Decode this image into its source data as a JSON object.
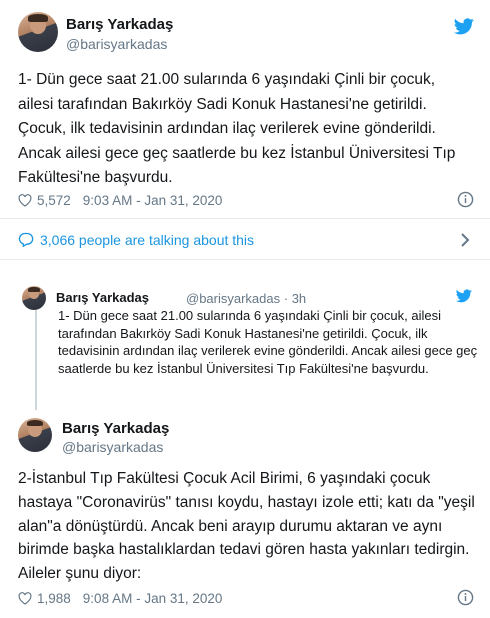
{
  "tweet1": {
    "author_name": "Barış Yarkadaş",
    "author_handle": "@barisyarkadas",
    "text": "1- Dün gece saat 21.00 sularında 6 yaşındaki Çinli bir çocuk, ailesi tarafından Bakırköy Sadi Konuk Hastanesi'ne getirildi. Çocuk, ilk tedavisinin ardından ilaç verilerek evine gönderildi. Ancak ailesi gece geç saatlerde bu kez İstanbul Üniversitesi Tıp Fakültesi'ne başvurdu.",
    "likes": "5,572",
    "timestamp": "9:03 AM - Jan 31, 2020",
    "talking": "3,066 people are talking about this"
  },
  "quoted": {
    "author_name": "Barış Yarkadaş",
    "author_handle": "@barisyarkadas",
    "time": "3h",
    "text": "1- Dün gece saat 21.00 sularında 6 yaşındaki Çinli bir çocuk, ailesi tarafından Bakırköy Sadi Konuk Hastanesi'ne getirildi. Çocuk, ilk tedavisinin ardından ilaç verilerek evine gönderildi. Ancak ailesi gece geç saatlerde bu kez İstanbul Üniversitesi Tıp Fakültesi'ne başvurdu."
  },
  "tweet2": {
    "author_name": "Barış Yarkadaş",
    "author_handle": "@barisyarkadas",
    "text": "2-İstanbul Tıp Fakültesi Çocuk Acil Birimi, 6 yaşındaki çocuk hastaya \"Coronavirüs\" tanısı koydu, hastayı izole etti; katı da \"yeşil alan\"a dönüştürdü. Ancak beni arayıp durumu aktaran ve aynı birimde başka hastalıklardan tedavi gören hasta yakınları tedirgin. Aileler şunu diyor:",
    "likes": "1,988",
    "timestamp": "9:08 AM - Jan 31, 2020"
  },
  "icons": {
    "brand": "twitter-bird-icon",
    "like": "heart-icon",
    "info": "info-icon",
    "reply": "speech-bubble-icon",
    "more": "chevron-right-icon"
  },
  "colors": {
    "accent": "#1da1f2",
    "link": "#1b95e0",
    "muted": "#657786",
    "text": "#14171a",
    "divider": "#e6ecf0"
  }
}
